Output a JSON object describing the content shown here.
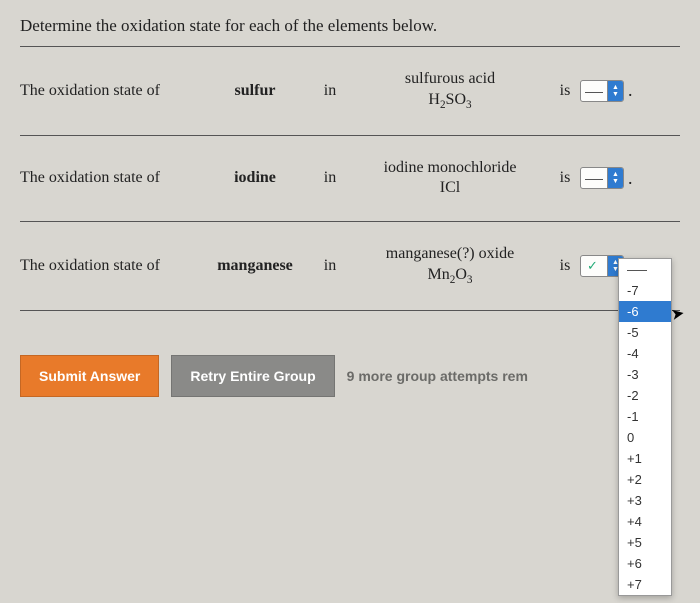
{
  "question": "Determine the oxidation state for each of the elements below.",
  "rows": [
    {
      "prefix": "The oxidation state of",
      "element": "sulfur",
      "in": "in",
      "compound_name": "sulfurous acid",
      "compound_formula_html": "H<sub>2</sub>SO<sub>3</sub>",
      "is": "is",
      "picker_checked": false
    },
    {
      "prefix": "The oxidation state of",
      "element": "iodine",
      "in": "in",
      "compound_name": "iodine monochloride",
      "compound_formula_html": "ICl",
      "is": "is",
      "picker_checked": false
    },
    {
      "prefix": "The oxidation state of",
      "element": "manganese",
      "in": "in",
      "compound_name": "manganese(?) oxide",
      "compound_formula_html": "Mn<sub>2</sub>O<sub>3</sub>",
      "is": "is",
      "picker_checked": true
    }
  ],
  "buttons": {
    "submit": "Submit Answer",
    "retry": "Retry Entire Group",
    "attempts": "9 more group attempts rem"
  },
  "dropdown": {
    "options": [
      "",
      "-7",
      "-6",
      "-5",
      "-4",
      "-3",
      "-2",
      "-1",
      "0",
      "+1",
      "+2",
      "+3",
      "+4",
      "+5",
      "+6",
      "+7"
    ],
    "highlighted": "-6"
  }
}
